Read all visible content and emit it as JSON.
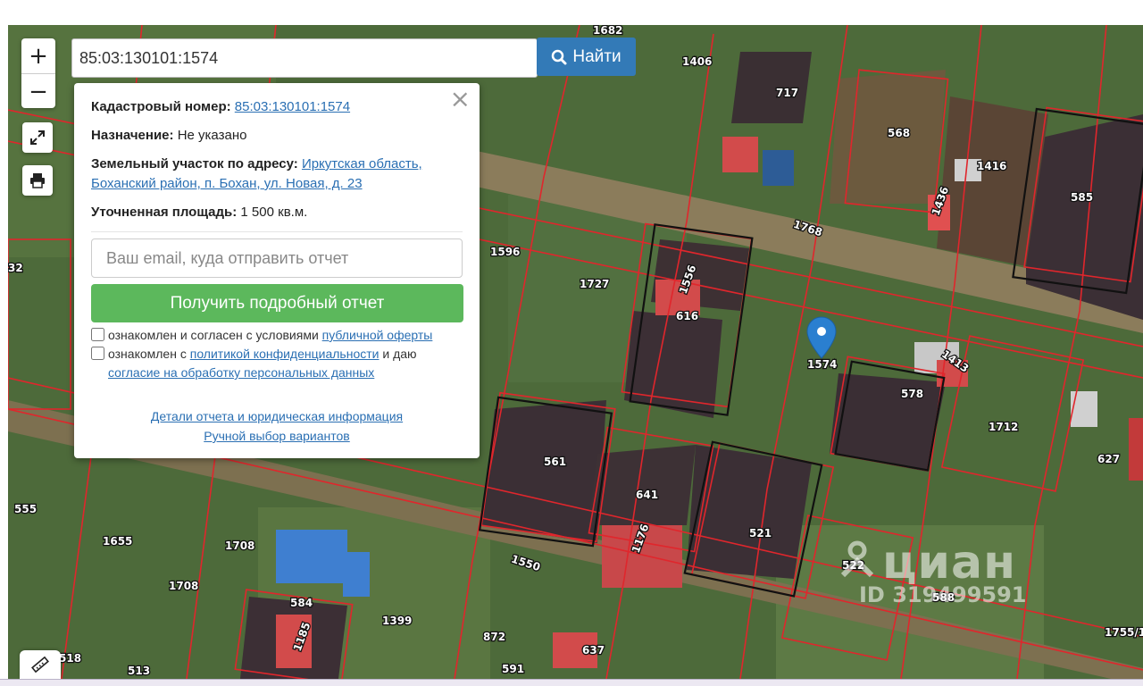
{
  "search": {
    "value": "85:03:130101:1574",
    "button_label": "Найти",
    "button_icon": "search-icon"
  },
  "controls": {
    "zoom_in": "+",
    "zoom_out": "−",
    "fullscreen_icon": "expand-icon",
    "print_icon": "print-icon",
    "ruler_icon": "ruler-icon"
  },
  "popup": {
    "cadastral_label": "Кадастровый номер:",
    "cadastral_value": "85:03:130101:1574",
    "purpose_label": "Назначение:",
    "purpose_value": "Не указано",
    "address_label": "Земельный участок по адресу:",
    "address_value": "Иркутская область, Боханский район, п. Бохан, ул. Новая, д. 23",
    "area_label": "Уточненная площадь:",
    "area_value": "1 500 кв.м.",
    "email_placeholder": "Ваш email, куда отправить отчет",
    "report_button": "Получить подробный отчет",
    "consent1_text": "ознакомлен и согласен с условиями",
    "consent1_link": "публичной оферты",
    "consent2_text": "ознакомлен с",
    "consent2_link": "политикой конфиденциальности",
    "consent2_text2": "и даю",
    "consent2_link2": "согласие на обработку персональных данных",
    "details_link": "Детали отчета и юридическая информация",
    "manual_link": "Ручной выбор вариантов",
    "close": "×"
  },
  "marker_label": "1574",
  "parcel_labels": [
    "1682",
    "1406",
    "717",
    "568",
    "1416",
    "1436",
    "585",
    "1768",
    "1596",
    "1727",
    "1556",
    "616",
    "32",
    "1413",
    "578",
    "1712",
    "627",
    "561",
    "641",
    "555",
    "1655",
    "1708",
    "1550",
    "1176",
    "521",
    "522",
    "588",
    "1708",
    "584",
    "1399",
    "872",
    "637",
    "1185",
    "518",
    "513",
    "591",
    "1755/1"
  ],
  "watermark": {
    "brand": "циан",
    "id": "ID 319499591"
  },
  "colors": {
    "search_button": "#337ab7",
    "report_button": "#5cb85c",
    "parcel_lines": "#e0262c",
    "marker": "#2a7fd0",
    "link": "#2a6fb3"
  }
}
